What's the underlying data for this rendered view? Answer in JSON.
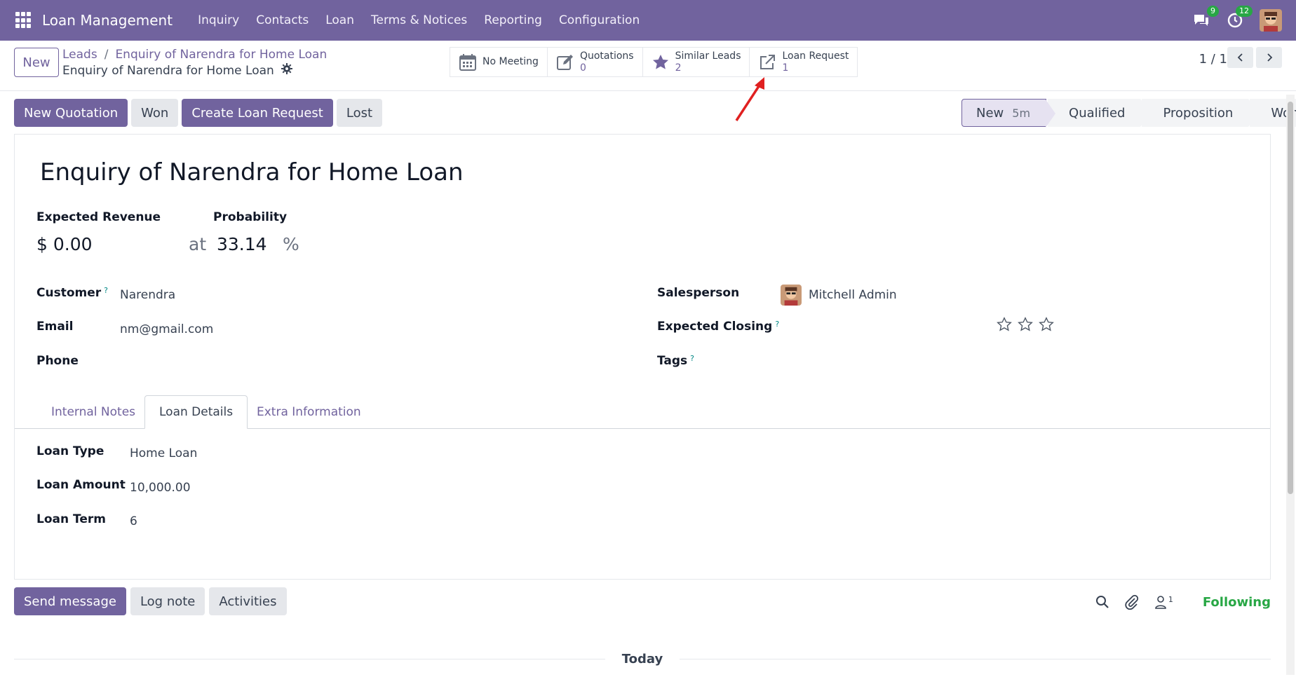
{
  "navbar": {
    "app_title": "Loan Management",
    "menu": [
      "Inquiry",
      "Contacts",
      "Loan",
      "Terms & Notices",
      "Reporting",
      "Configuration"
    ],
    "messages_count": "9",
    "activities_count": "12"
  },
  "control": {
    "new_label": "New",
    "breadcrumb": [
      "Leads",
      "Enquiry of Narendra for Home Loan"
    ],
    "current": "Enquiry of Narendra for Home Loan",
    "smart_buttons": [
      {
        "title": "No Meeting",
        "value": ""
      },
      {
        "title": "Quotations",
        "value": "0"
      },
      {
        "title": "Similar Leads",
        "value": "2"
      },
      {
        "title": "Loan Request",
        "value": "1"
      }
    ],
    "pager": "1 / 1"
  },
  "actions": [
    "New Quotation",
    "Won",
    "Create Loan Request",
    "Lost"
  ],
  "stages": [
    {
      "label": "New",
      "age": "5m"
    },
    {
      "label": "Qualified"
    },
    {
      "label": "Proposition"
    },
    {
      "label": "Won"
    }
  ],
  "form": {
    "title": "Enquiry of Narendra for Home Loan",
    "expected_revenue_label": "Expected Revenue",
    "probability_label": "Probability",
    "revenue_value": "$ 0.00",
    "at_label": "at",
    "probability_value": "33.14",
    "percent": "%",
    "customer_label": "Customer",
    "customer_value": "Narendra",
    "email_label": "Email",
    "email_value": "nm@gmail.com",
    "phone_label": "Phone",
    "salesperson_label": "Salesperson",
    "salesperson_value": "Mitchell Admin",
    "expected_closing_label": "Expected Closing",
    "tags_label": "Tags",
    "help_mark": "?"
  },
  "tabs": [
    "Internal Notes",
    "Loan Details",
    "Extra Information"
  ],
  "loan_details": {
    "loan_type_label": "Loan Type",
    "loan_type_value": "Home Loan",
    "loan_amount_label": "Loan Amount",
    "loan_amount_value": "10,000.00",
    "loan_term_label": "Loan Term",
    "loan_term_value": "6"
  },
  "chatter": {
    "send_message": "Send message",
    "log_note": "Log note",
    "activities": "Activities",
    "followers_count": "1",
    "following": "Following",
    "today": "Today"
  },
  "colors": {
    "brand": "#71639e",
    "success": "#28a745",
    "annotation_arrow": "#e02020"
  }
}
